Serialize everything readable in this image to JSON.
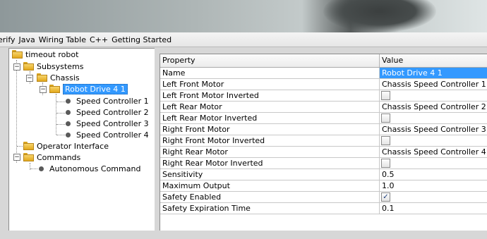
{
  "menu": [
    "erify",
    "Java",
    "Wiring Table",
    "C++",
    "Getting Started"
  ],
  "tree": {
    "root": "timeout robot",
    "subsystems": "Subsystems",
    "chassis": "Chassis",
    "robot_drive": "Robot Drive 4 1",
    "speed_controllers": [
      "Speed Controller 1",
      "Speed Controller 2",
      "Speed Controller 3",
      "Speed Controller 4"
    ],
    "operator_interface": "Operator Interface",
    "commands": "Commands",
    "autonomous": "Autonomous Command"
  },
  "table": {
    "headers": [
      "Property",
      "Value"
    ],
    "rows": [
      {
        "property": "Name",
        "value": "Robot Drive 4 1",
        "kind": "text",
        "selected": true
      },
      {
        "property": "Left Front Motor",
        "value": "Chassis Speed Controller 1",
        "kind": "text"
      },
      {
        "property": "Left Front Motor Inverted",
        "value": "",
        "kind": "checkbox",
        "checked": false
      },
      {
        "property": "Left Rear Motor",
        "value": "Chassis Speed Controller 2",
        "kind": "text"
      },
      {
        "property": "Left Rear Motor Inverted",
        "value": "",
        "kind": "checkbox",
        "checked": false
      },
      {
        "property": "Right Front Motor",
        "value": "Chassis Speed Controller 3",
        "kind": "text"
      },
      {
        "property": "Right Front Motor Inverted",
        "value": "",
        "kind": "checkbox",
        "checked": false
      },
      {
        "property": "Right Rear Motor",
        "value": "Chassis Speed Controller 4",
        "kind": "text"
      },
      {
        "property": "Right Rear Motor Inverted",
        "value": "",
        "kind": "checkbox",
        "checked": false
      },
      {
        "property": "Sensitivity",
        "value": "0.5",
        "kind": "text"
      },
      {
        "property": "Maximum Output",
        "value": "1.0",
        "kind": "text"
      },
      {
        "property": "Safety Enabled",
        "value": "",
        "kind": "checkbox",
        "checked": true
      },
      {
        "property": "Safety Expiration Time",
        "value": "0.1",
        "kind": "text"
      }
    ]
  },
  "icons": {
    "folder": "folder-icon",
    "leaf": "bullet-icon",
    "collapse": "minus-toggle-icon"
  },
  "colors": {
    "selection": "#3399ff",
    "folder": "#e8b430"
  }
}
